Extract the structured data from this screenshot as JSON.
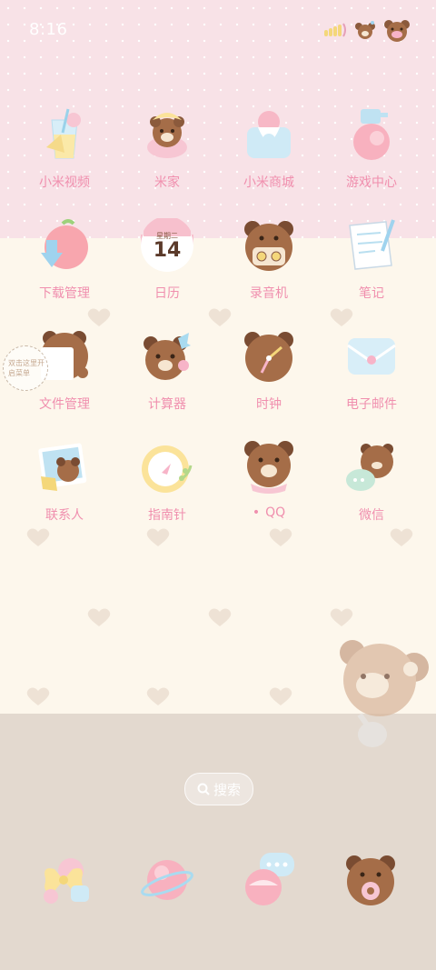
{
  "status_bar": {
    "time": "8:16"
  },
  "apps": [
    {
      "label": "小米视频",
      "icon": "juice-cup-icon"
    },
    {
      "label": "米家",
      "icon": "bear-hat-icon"
    },
    {
      "label": "小米商城",
      "icon": "shopping-bag-icon"
    },
    {
      "label": "游戏中心",
      "icon": "peach-icon"
    },
    {
      "label": "下载管理",
      "icon": "apple-download-icon"
    },
    {
      "label": "日历",
      "icon": "calendar-icon"
    },
    {
      "label": "录音机",
      "icon": "bear-cassette-icon"
    },
    {
      "label": "笔记",
      "icon": "notepad-icon"
    },
    {
      "label": "文件管理",
      "icon": "bear-file-icon"
    },
    {
      "label": "计算器",
      "icon": "bear-bow-icon"
    },
    {
      "label": "时钟",
      "icon": "bear-clock-icon"
    },
    {
      "label": "电子邮件",
      "icon": "envelope-icon"
    },
    {
      "label": "联系人",
      "icon": "photo-bear-icon"
    },
    {
      "label": "指南针",
      "icon": "compass-icon"
    },
    {
      "label": "QQ",
      "icon": "bear-scarf-icon"
    },
    {
      "label": "微信",
      "icon": "bear-chat-icon"
    }
  ],
  "calendar": {
    "weekday": "星期二",
    "day": "14"
  },
  "qq_dot": "•",
  "tip_text": "双击这里开启菜单",
  "search": {
    "label": "搜索"
  },
  "dock": [
    "bow-icon",
    "planet-icon",
    "peach-chat-icon",
    "bear-donut-icon"
  ]
}
